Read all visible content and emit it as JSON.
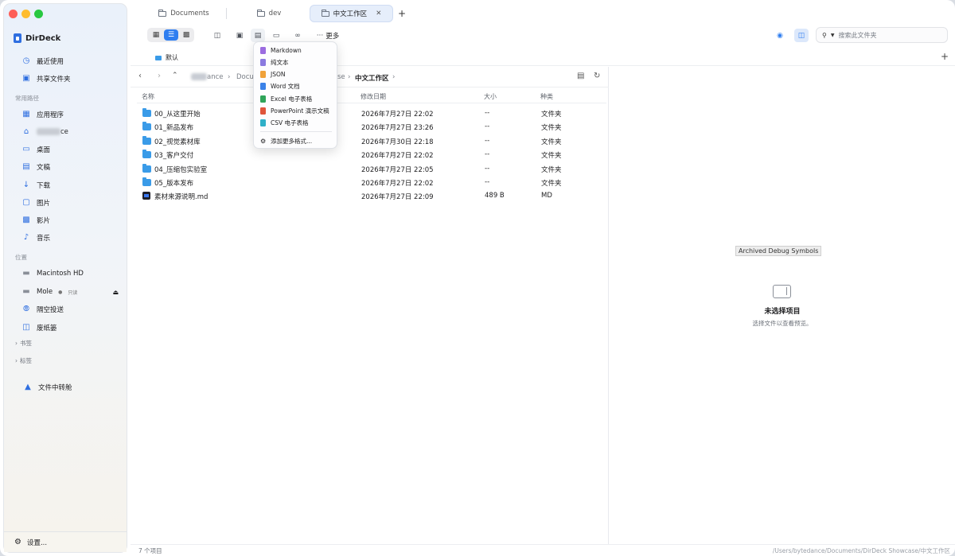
{
  "app": {
    "name": "DirDeck"
  },
  "tabs": [
    {
      "label": "Documents",
      "active": false
    },
    {
      "label": "dev",
      "active": false
    },
    {
      "label": "中文工作区",
      "active": true
    }
  ],
  "toolbar": {
    "more_label": "更多",
    "more_glyph": "···",
    "search_placeholder": "搜索此文件夹"
  },
  "favorites": {
    "label": "默认",
    "add_glyph": "+"
  },
  "sidebar": {
    "top_items": [
      {
        "label": "最近使用",
        "icon": "clock-icon"
      },
      {
        "label": "共享文件夹",
        "icon": "shared-folder-icon"
      }
    ],
    "section_paths": "常用路径",
    "path_items": [
      {
        "label": "应用程序",
        "icon": "apps-icon"
      },
      {
        "label": "ce",
        "icon": "home-icon"
      },
      {
        "label": "桌面",
        "icon": "desktop-icon"
      },
      {
        "label": "文稿",
        "icon": "document-icon"
      },
      {
        "label": "下载",
        "icon": "download-icon"
      },
      {
        "label": "图片",
        "icon": "photo-icon"
      },
      {
        "label": "影片",
        "icon": "movie-icon"
      },
      {
        "label": "音乐",
        "icon": "music-icon"
      }
    ],
    "section_locations": "位置",
    "location_items": [
      {
        "label": "Macintosh HD",
        "icon": "disk-icon"
      },
      {
        "label": "Mole",
        "icon": "drive-icon",
        "badge": "只读"
      },
      {
        "label": "隔空投送",
        "icon": "airdrop-icon"
      },
      {
        "label": "废纸篓",
        "icon": "trash-icon"
      }
    ],
    "bookmarks": "书签",
    "tags": "标签",
    "transfer": "文件中转舱",
    "settings": "设置..."
  },
  "breadcrumb": {
    "items": [
      "ance",
      "Docu",
      "se",
      "中文工作区"
    ]
  },
  "columns": {
    "name": "名称",
    "modified": "修改日期",
    "size": "大小",
    "kind": "种类"
  },
  "files": [
    {
      "name": "00_从这里开始",
      "modified": "2026年7月27日 22:02",
      "size": "--",
      "kind": "文件夹",
      "type": "folder"
    },
    {
      "name": "01_新品发布",
      "modified": "2026年7月27日 23:26",
      "size": "--",
      "kind": "文件夹",
      "type": "folder"
    },
    {
      "name": "02_视觉素材库",
      "modified": "2026年7月30日 22:18",
      "size": "--",
      "kind": "文件夹",
      "type": "folder"
    },
    {
      "name": "03_客户交付",
      "modified": "2026年7月27日 22:02",
      "size": "--",
      "kind": "文件夹",
      "type": "folder"
    },
    {
      "name": "04_压缩包实验室",
      "modified": "2026年7月27日 22:05",
      "size": "--",
      "kind": "文件夹",
      "type": "folder"
    },
    {
      "name": "05_版本发布",
      "modified": "2026年7月27日 22:02",
      "size": "--",
      "kind": "文件夹",
      "type": "folder"
    },
    {
      "name": "素材来源说明.md",
      "modified": "2026年7月27日 22:09",
      "size": "489 B",
      "kind": "MD",
      "type": "markdown"
    }
  ],
  "new_file_menu": {
    "items": [
      {
        "label": "Markdown",
        "color": "#9b6ce0"
      },
      {
        "label": "纯文本",
        "color": "#8a7ae0"
      },
      {
        "label": "JSON",
        "color": "#f0a23a"
      },
      {
        "label": "Word 文档",
        "color": "#3b82e8"
      },
      {
        "label": "Excel 电子表格",
        "color": "#2fa45a"
      },
      {
        "label": "PowerPoint 演示文稿",
        "color": "#e0553b"
      },
      {
        "label": "CSV 电子表格",
        "color": "#2fb0c8"
      }
    ],
    "more": "添加更多格式..."
  },
  "preview": {
    "tooltip": "Archived Debug Symbols",
    "empty_title": "未选择项目",
    "empty_subtitle": "选择文件以查看预览。"
  },
  "status": {
    "count": "7 个项目",
    "path": "/Users/bytedance/Documents/DirDeck Showcase/中文工作区"
  },
  "colors": {
    "accent": "#2f7ef0",
    "folder": "#3a9be8"
  }
}
